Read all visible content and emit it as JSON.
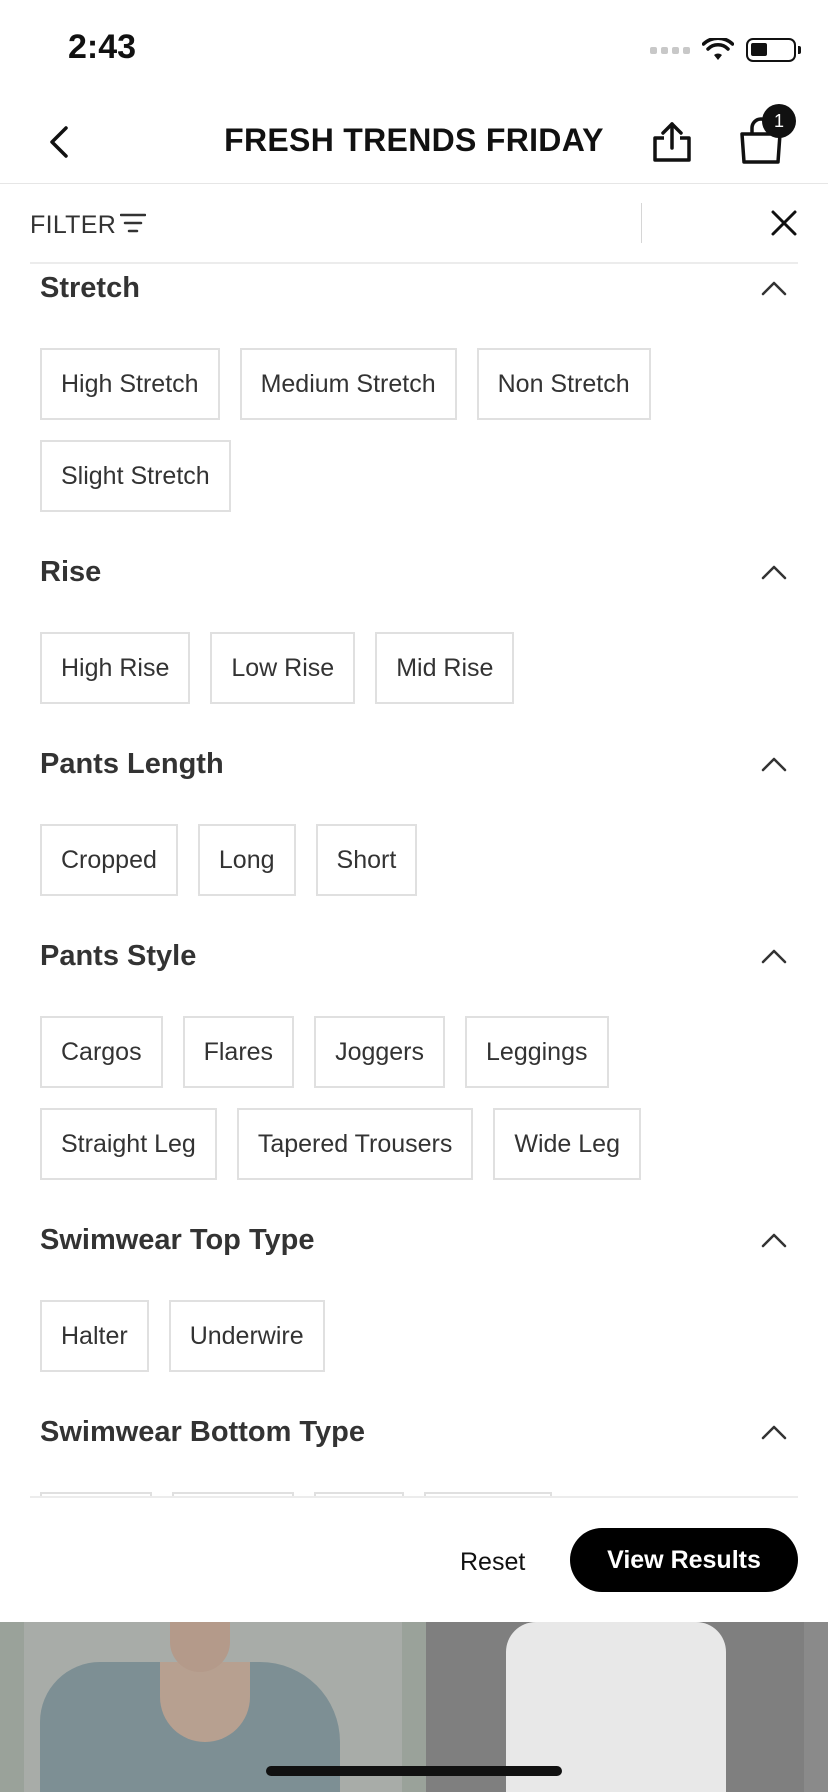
{
  "status_bar": {
    "time": "2:43"
  },
  "header": {
    "title": "FRESH TRENDS FRIDAY",
    "bag_count": "1"
  },
  "filter_bar": {
    "label": "FILTER"
  },
  "sections": [
    {
      "title": "Stretch",
      "options": [
        "High Stretch",
        "Medium Stretch",
        "Non Stretch",
        "Slight Stretch"
      ]
    },
    {
      "title": "Rise",
      "options": [
        "High Rise",
        "Low Rise",
        "Mid Rise"
      ]
    },
    {
      "title": "Pants Length",
      "options": [
        "Cropped",
        "Long",
        "Short"
      ]
    },
    {
      "title": "Pants Style",
      "options": [
        "Cargos",
        "Flares",
        "Joggers",
        "Leggings",
        "Straight Leg",
        "Tapered Trousers",
        "Wide Leg"
      ]
    },
    {
      "title": "Swimwear Top Type",
      "options": [
        "Halter",
        "Underwire"
      ]
    },
    {
      "title": "Swimwear Bottom Type",
      "options": []
    }
  ],
  "actions": {
    "reset": "Reset",
    "view_results": "View Results"
  },
  "icons": [
    "back-chevron-icon",
    "share-icon",
    "shopping-bag-icon",
    "filter-lines-icon",
    "close-icon",
    "chevron-up-icon",
    "wifi-icon",
    "battery-icon"
  ]
}
